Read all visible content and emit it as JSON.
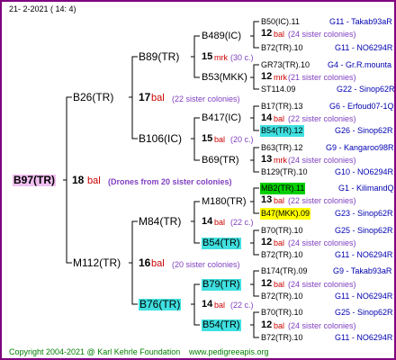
{
  "header": {
    "date": "21-  2-2021  ( 14:  4)"
  },
  "root": {
    "label": "B97(TR)",
    "num": "18",
    "unit": "bal",
    "note": "(Drones from 20 sister colonies)"
  },
  "gen1": [
    {
      "label": "B26(TR)"
    },
    {
      "label": "M112(TR)"
    }
  ],
  "gen2": [
    {
      "label": "B89(TR)",
      "num": "17",
      "unit": "bal",
      "note": "(22 sister colonies)"
    },
    {
      "label": "B106(IC)"
    },
    {
      "label": "M84(TR)",
      "num": "16",
      "unit": "bal",
      "note": "(20 sister colonies)"
    },
    {
      "label": "B76(TR)"
    }
  ],
  "gen3": [
    {
      "label": "B489(IC)",
      "num": "15",
      "unit": "mrk",
      "note": "(30 c.)"
    },
    {
      "label": "B53(MKK)"
    },
    {
      "label": "B417(IC)",
      "num": "15",
      "unit": "bal",
      "note": "(20 c.)"
    },
    {
      "label": "B69(TR)"
    },
    {
      "label": "M180(TR)",
      "num": "14",
      "unit": "bal",
      "note": "(22 c.)"
    },
    {
      "label": "B54(TR)"
    },
    {
      "label": "B79(TR)",
      "num": "14",
      "unit": "bal",
      "note": "(22 c.)"
    },
    {
      "label": "B54(TR)"
    }
  ],
  "gen4": [
    {
      "label": "B50(IC).11",
      "origin": "G11 - Takab93aR",
      "num": "12",
      "unit": "bal",
      "note": "(24 sister colonies)",
      "label2": "B72(TR).10",
      "origin2": "G11 - NO6294R"
    },
    {
      "label": "GR73(TR).10",
      "origin": "G4 - Gr.R.mounta",
      "num": "12",
      "unit": "mrk",
      "note": "(21 sister colonies)",
      "label2": "ST114.09",
      "origin2": "G22 - Sinop62R"
    },
    {
      "label": "B17(TR).13",
      "origin": "G6 - Erfoud07-1Q",
      "num": "14",
      "unit": "bal",
      "note": "(22 sister colonies)",
      "label2": "B54(TR).12",
      "origin2": "G26 - Sinop62R"
    },
    {
      "label": "B63(TR).12",
      "origin": "G9 - Kangaroo98R",
      "num": "13",
      "unit": "mrk",
      "note": "(24 sister colonies)",
      "label2": "B129(TR).10",
      "origin2": "G10 - NO6294R"
    },
    {
      "label": "MB2(TR).11",
      "origin": "G1 - KilimandQ",
      "num": "13",
      "unit": "bal",
      "note": "(22 sister colonies)",
      "label2": "B47(MKK).09",
      "origin2": "G23 - Sinop62R"
    },
    {
      "label": "B70(TR).10",
      "origin": "G25 - Sinop62R",
      "num": "12",
      "unit": "bal",
      "note": "(24 sister colonies)",
      "label2": "B72(TR).10",
      "origin2": "G11 - NO6294R"
    },
    {
      "label": "B174(TR).09",
      "origin": "G9 - Takab93aR",
      "num": "12",
      "unit": "bal",
      "note": "(24 sister colonies)",
      "label2": "B72(TR).10",
      "origin2": "G11 - NO6294R"
    },
    {
      "label": "B70(TR).10",
      "origin": "G25 - Sinop62R",
      "num": "12",
      "unit": "bal",
      "note": "(24 sister colonies)",
      "label2": "B72(TR).10",
      "origin2": "G11 - NO6294R"
    }
  ],
  "footer": {
    "copyright": "Copyright 2004-2021 @ Karl Kehrle Foundation",
    "url": "www.pedigreeapis.org"
  },
  "colors": {
    "frame": "#800080",
    "root_bg": "#f0c0f0",
    "cyan_bg": "#40e0e0",
    "green_bg": "#00d000",
    "yellow_bg": "#ffff00",
    "origin": "#0000b0",
    "unit": "#cc0000",
    "note": "#8040c0",
    "footer": "#008000"
  }
}
